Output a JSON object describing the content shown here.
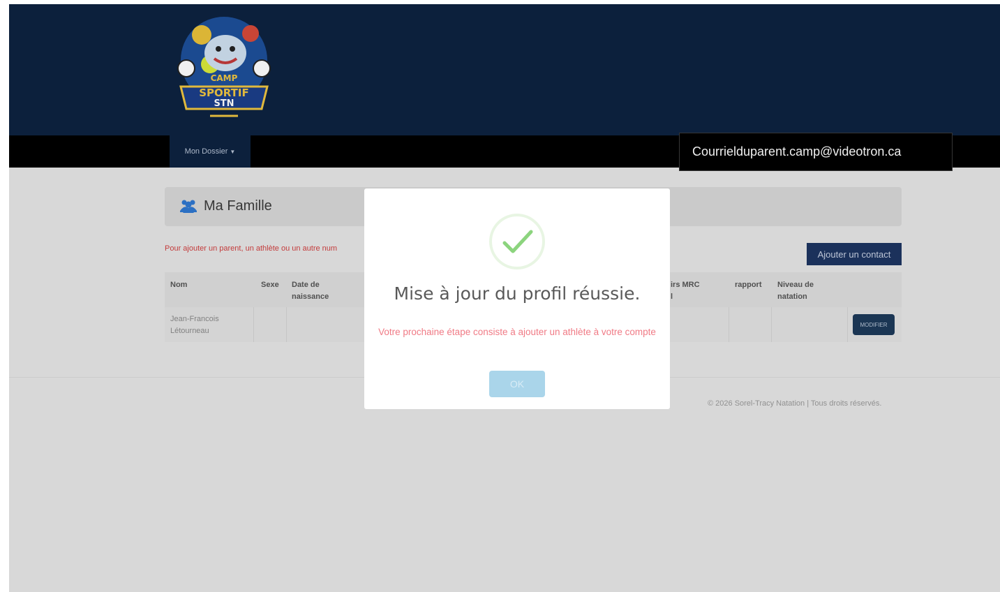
{
  "header": {
    "logo": {
      "line1": "CAMP",
      "line2": "SPORTIF",
      "line3": "STN"
    }
  },
  "nav": {
    "dossier_label": "Mon Dossier",
    "email": "Courrielduparent.camp@videotron.ca"
  },
  "family_panel": {
    "title": "Ma Famille",
    "icon": "users-icon"
  },
  "hint_text": "Pour ajouter un parent, un athlète ou un autre num",
  "add_contact_label": "Ajouter un contact",
  "table": {
    "headers": {
      "nom": "Nom",
      "sexe": "Sexe",
      "date1": "Date de",
      "date2": "naissance",
      "mrc1": "irs MRC",
      "mrc2": "l",
      "rapport": "rapport",
      "niveau1": "Niveau de",
      "niveau2": "natation"
    },
    "rows": [
      {
        "name1": "Jean-Francois",
        "name2": "Létourneau",
        "action": "MODIFIER"
      }
    ]
  },
  "footer": {
    "copyright": "© 2026 Sorel-Tracy Natation | Tous droits réservés."
  },
  "modal": {
    "title": "Mise à jour du profil réussie.",
    "text": "Votre prochaine étape consiste à ajouter un athlète à votre compte",
    "ok_label": "OK",
    "icon": "success-check-icon"
  },
  "colors": {
    "header_bg": "#0d2240",
    "navbar_bg": "#000000",
    "button_bg": "#1d3561",
    "error_text": "#f07a85",
    "success_green": "#8cd47e"
  }
}
